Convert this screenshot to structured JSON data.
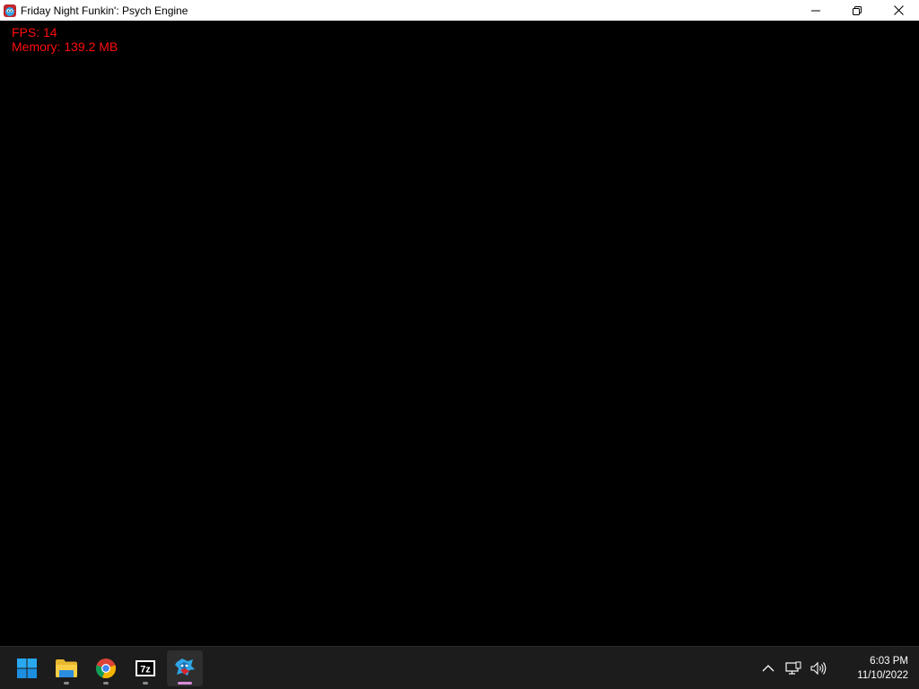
{
  "window": {
    "title": "Friday Night Funkin': Psych Engine",
    "app_icon": "fnf-app-icon",
    "controls": [
      "minimize-icon",
      "restore-icon",
      "close-icon"
    ]
  },
  "game": {
    "fps_label": "FPS: 14",
    "memory_label": "Memory: 139.2 MB",
    "overlay_color": "#ff0d0d",
    "background_color": "#000000"
  },
  "taskbar": {
    "apps": [
      {
        "name": "Start",
        "icon": "windows-start-icon"
      },
      {
        "name": "File Explorer",
        "icon": "folder-icon"
      },
      {
        "name": "Google Chrome",
        "icon": "chrome-icon"
      },
      {
        "name": "7-Zip",
        "icon": "7zip-icon",
        "icon_text": "7z"
      },
      {
        "name": "Friday Night Funkin'",
        "icon": "fnf-icon"
      }
    ],
    "tray": {
      "icons": [
        "chevron-up-icon",
        "network-icon",
        "volume-icon"
      ],
      "time": "6:03 PM",
      "date": "11/10/2022"
    },
    "background_color": "#1c1c1c"
  }
}
